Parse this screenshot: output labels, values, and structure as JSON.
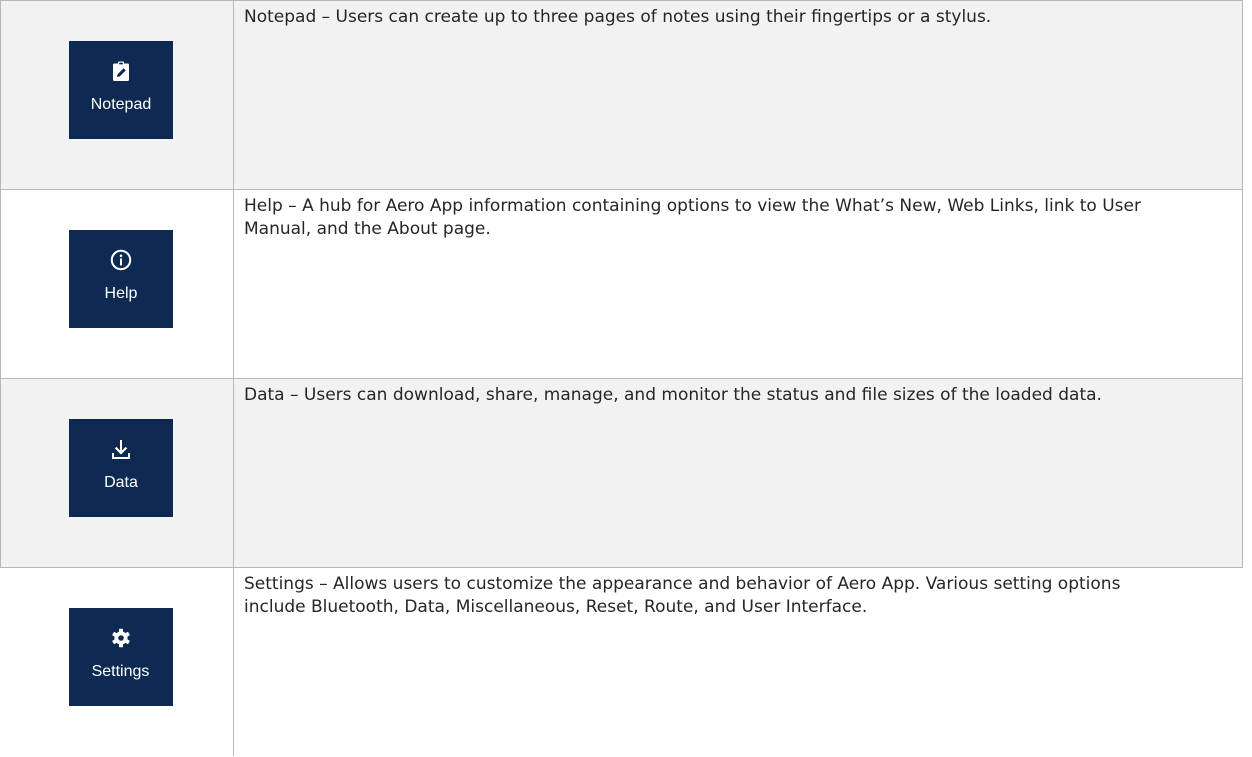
{
  "colors": {
    "tile_background": "#0e2a52",
    "tile_foreground": "#ffffff",
    "row_shade": "#f2f2f2",
    "border": "#b8b8b8",
    "text": "#262626"
  },
  "rows": [
    {
      "icon": "clipboard-edit-icon",
      "tile_label": "Notepad",
      "description": "Notepad – Users can create up to three pages of notes using their fingertips or a stylus."
    },
    {
      "icon": "info-circle-icon",
      "tile_label": "Help",
      "description": "Help – A hub for Aero App information containing options to view the What’s New, Web Links, link to User Manual, and the About page."
    },
    {
      "icon": "download-icon",
      "tile_label": "Data",
      "description": "Data – Users can download, share, manage, and monitor the status and file sizes of the loaded data."
    },
    {
      "icon": "gear-icon",
      "tile_label": "Settings",
      "description": "Settings – Allows users to customize the appearance and behavior of Aero App. Various setting options include Bluetooth, Data, Miscellaneous, Reset, Route, and User Interface."
    }
  ]
}
